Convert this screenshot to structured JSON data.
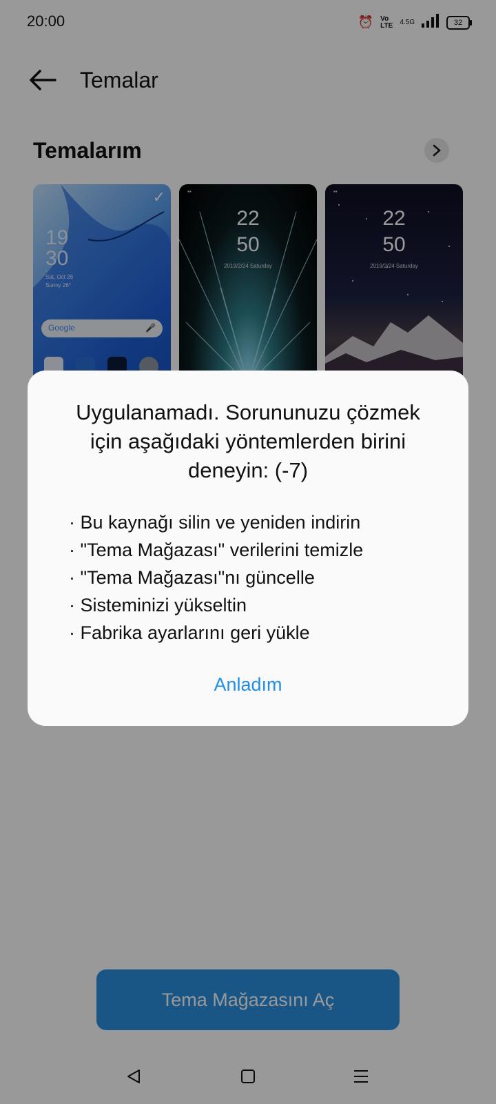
{
  "status": {
    "time": "20:00",
    "battery": "32",
    "network": "4.5G"
  },
  "header": {
    "title": "Temalar"
  },
  "section": {
    "title": "Temalarım"
  },
  "themes": [
    {
      "clock_hour": "19",
      "clock_min": "30",
      "date": "Sat, Oct 26",
      "weather": "Sunny 26°",
      "search_label": "Google"
    },
    {
      "clock_hour": "22",
      "clock_min": "50",
      "date": "2019/2/24 Saturday"
    },
    {
      "clock_hour": "22",
      "clock_min": "50",
      "date": "2019/2/24 Saturday"
    }
  ],
  "dialog": {
    "title": "Uygulanamadı. Sorununuzu çözmek için aşağıdaki yöntemlerden birini deneyin: (-7)",
    "items": [
      "· Bu kaynağı silin ve yeniden indirin",
      "· \"Tema Mağazası\" verilerini temizle",
      "· \"Tema Mağazası\"nı güncelle",
      "· Sisteminizi yükseltin",
      "· Fabrika ayarlarını geri yükle"
    ],
    "ok_label": "Anladım"
  },
  "bottom": {
    "open_store_label": "Tema Mağazasını Aç"
  },
  "colors": {
    "accent": "#1f8fe6",
    "button": "#2b8fe0",
    "scrim": "rgba(0,0,0,0.40)"
  }
}
